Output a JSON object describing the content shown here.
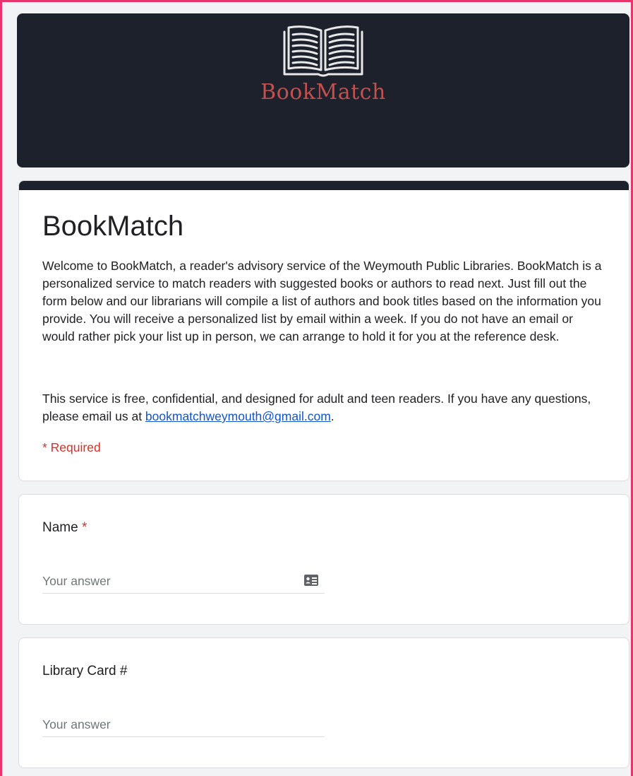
{
  "header": {
    "logo_text": "BookMatch"
  },
  "form": {
    "title": "BookMatch",
    "description_p1": "Welcome to BookMatch, a reader's advisory service of the Weymouth Public Libraries. BookMatch is a personalized service to match readers with suggested books or authors to read next. Just fill out the form below and our librarians will compile a list of authors and book titles based on the information you provide. You will receive a personalized list by email within a week. If you do not have an email or would rather pick your list up in person, we can arrange to hold it for you at the reference desk.",
    "description_p2_before": "This service is free, confidential, and designed for adult and teen readers. If you have any questions, please email us at ",
    "email_link": "bookmatchweymouth@gmail.com",
    "description_p2_after": ".",
    "required_note": "* Required"
  },
  "questions": [
    {
      "label": "Name",
      "required_marker": "*",
      "placeholder": "Your answer",
      "icon": "contact-card-icon"
    },
    {
      "label": "Library Card #",
      "placeholder": "Your answer"
    }
  ],
  "colors": {
    "frame_border": "#e8356e",
    "header_bg": "#1c212b",
    "logo_text": "#c3504e",
    "page_bg": "#f1f3f4",
    "required": "#d93025",
    "link": "#1155cc"
  }
}
